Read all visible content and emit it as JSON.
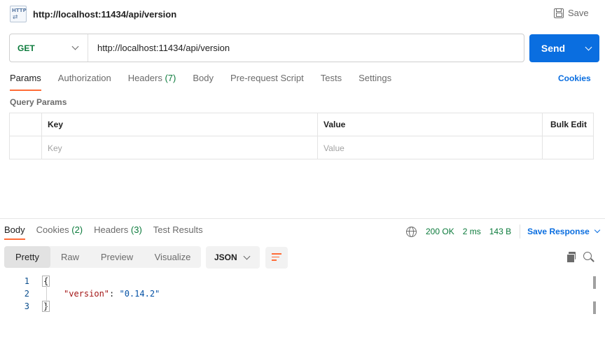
{
  "header": {
    "icon": "http-request-icon",
    "icon_text": "HTTP",
    "title": "http://localhost:11434/api/version",
    "save_label": "Save"
  },
  "request": {
    "method": "GET",
    "url": "http://localhost:11434/api/version",
    "send_label": "Send"
  },
  "request_tabs": [
    {
      "label": "Params",
      "count": "",
      "active": true
    },
    {
      "label": "Authorization",
      "count": "",
      "active": false
    },
    {
      "label": "Headers",
      "count": "(7)",
      "active": false
    },
    {
      "label": "Body",
      "count": "",
      "active": false
    },
    {
      "label": "Pre-request Script",
      "count": "",
      "active": false
    },
    {
      "label": "Tests",
      "count": "",
      "active": false
    },
    {
      "label": "Settings",
      "count": "",
      "active": false
    }
  ],
  "cookies_label": "Cookies",
  "query_params": {
    "section_label": "Query Params",
    "columns": {
      "key": "Key",
      "value": "Value",
      "bulk": "Bulk Edit"
    },
    "placeholder_row": {
      "key": "Key",
      "value": "Value"
    }
  },
  "response_tabs": [
    {
      "label": "Body",
      "count": "",
      "active": true
    },
    {
      "label": "Cookies",
      "count": "(2)",
      "active": false
    },
    {
      "label": "Headers",
      "count": "(3)",
      "active": false
    },
    {
      "label": "Test Results",
      "count": "",
      "active": false
    }
  ],
  "response_status": {
    "status": "200 OK",
    "time": "2 ms",
    "size": "143 B",
    "save_response_label": "Save Response"
  },
  "response_view": {
    "modes": [
      "Pretty",
      "Raw",
      "Preview",
      "Visualize"
    ],
    "active_mode": "Pretty",
    "format": "JSON"
  },
  "response_body": {
    "lines": [
      {
        "n": "1",
        "open": "{"
      },
      {
        "n": "2",
        "key": "\"version\"",
        "sep": ": ",
        "value": "\"0.14.2\""
      },
      {
        "n": "3",
        "close": "}"
      }
    ]
  },
  "colors": {
    "accent": "#ff6c37",
    "primary": "#0a6ee0",
    "success": "#0b7a3b"
  }
}
